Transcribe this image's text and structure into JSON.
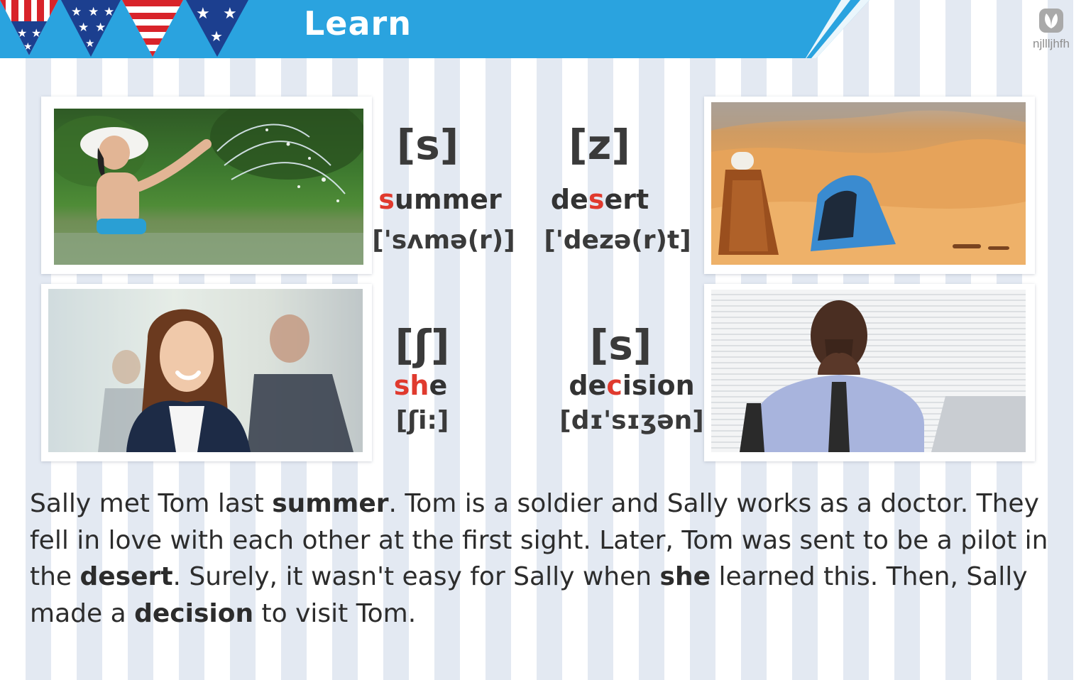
{
  "header": {
    "title": "Learn",
    "logo_text": "njllljhfh",
    "accent_color": "#2aa3df"
  },
  "cards": [
    {
      "ipa": "[s]",
      "word_pre": "",
      "word_hi": "s",
      "word_post": "ummer",
      "phonetic": "['sʌmə(r)]",
      "image": "woman-splashing-water-at-lake"
    },
    {
      "ipa": "[z]",
      "word_pre": "de",
      "word_hi": "s",
      "word_post": "ert",
      "phonetic": "['dezə(r)t]",
      "image": "two-people-sitting-in-desert-dunes"
    },
    {
      "ipa": "[ʃ]",
      "word_pre": "",
      "word_hi": "sh",
      "word_post": "e",
      "phonetic": "[ʃi:]",
      "image": "smiling-businesswoman-in-office"
    },
    {
      "ipa": "[s]",
      "word_pre": "de",
      "word_hi": "c",
      "word_post": "ision",
      "phonetic": "[dɪ'sɪʒən]",
      "image": "worried-man-at-laptop"
    }
  ],
  "story": {
    "segments": [
      {
        "text": "Sally met Tom last ",
        "bold": false
      },
      {
        "text": "summer",
        "bold": true
      },
      {
        "text": ". Tom is a soldier and Sally works as a doctor. They fell in love with each other at the first sight. Later, Tom was sent to be a pilot in the ",
        "bold": false
      },
      {
        "text": "desert",
        "bold": true
      },
      {
        "text": ". Surely, it wasn't easy for Sally when ",
        "bold": false
      },
      {
        "text": "she",
        "bold": true
      },
      {
        "text": " learned this. Then, Sally made a ",
        "bold": false
      },
      {
        "text": "decision",
        "bold": true
      },
      {
        "text": " to visit Tom.",
        "bold": false
      }
    ]
  },
  "colors": {
    "highlight": "#e03a2e",
    "text": "#333333"
  }
}
